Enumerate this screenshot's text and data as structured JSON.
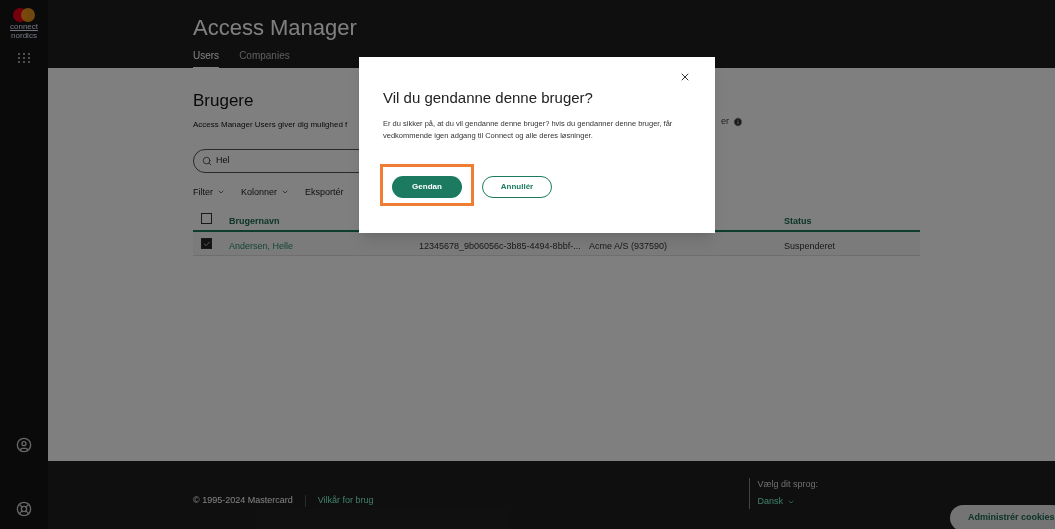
{
  "sidebar": {
    "logo_caption": "connect",
    "logo_subcaption": "nordics"
  },
  "header": {
    "title": "Access Manager",
    "tabs": [
      {
        "label": "Users",
        "selected": true
      },
      {
        "label": "Companies",
        "selected": false
      }
    ]
  },
  "content": {
    "heading": "Brugere",
    "description": "Access Manager Users giver dig mulighed f",
    "description_tail": "er",
    "search": {
      "value": "Hel"
    },
    "toolbar": [
      {
        "label": "Filter",
        "dropdown": true
      },
      {
        "label": "Kolonner",
        "dropdown": true
      },
      {
        "label": "Eksportér",
        "dropdown": false
      }
    ],
    "table": {
      "header_checked": false,
      "columns": [
        "Brugernavn",
        "",
        "",
        "Status"
      ],
      "rows": [
        {
          "checked": true,
          "cells": [
            "Andersen, Helle",
            "12345678_9b06056c-3b85-4494-8bbf-...",
            "Acme A/S (937590)",
            "Suspenderet"
          ]
        }
      ]
    }
  },
  "footer": {
    "copyright": "© 1995-2024 Mastercard",
    "terms_link": "Vilkår for brug",
    "language_label": "Vælg dit sprog:",
    "language_value": "Dansk",
    "cookies_button": "Administrér cookies"
  },
  "dialog": {
    "title": "Vil du gendanne denne bruger?",
    "body": "Er du sikker på, at du vil gendanne denne bruger? hvis du gendanner denne bruger, får vedkommende igen adgang til Connect og alle deres løsninger.",
    "buttons": [
      {
        "label": "Gendan",
        "kind": "primary",
        "highlighted": true
      },
      {
        "label": "Annullér",
        "kind": "secondary",
        "highlighted": false
      }
    ]
  }
}
